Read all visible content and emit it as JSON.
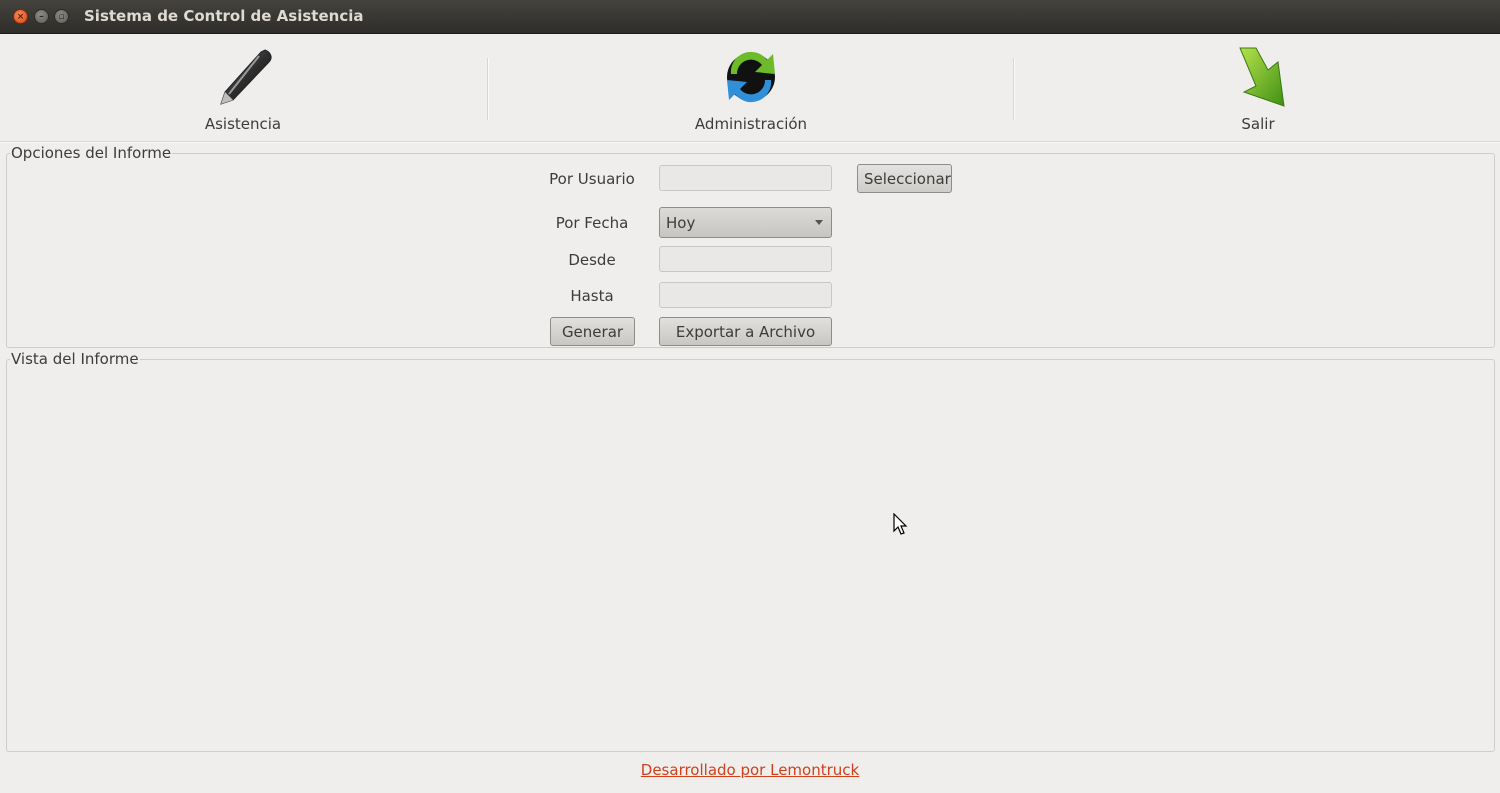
{
  "window": {
    "title": "Sistema de Control de Asistencia"
  },
  "toolbar": {
    "items": [
      {
        "label": "Asistencia",
        "icon": "pen-icon"
      },
      {
        "label": "Administración",
        "icon": "sync-icon"
      },
      {
        "label": "Salir",
        "icon": "exit-arrow-icon"
      }
    ]
  },
  "options": {
    "title": "Opciones del Informe",
    "por_usuario_label": "Por Usuario",
    "por_usuario_value": "",
    "seleccionar_label": "Seleccionar",
    "por_fecha_label": "Por Fecha",
    "por_fecha_value": "Hoy",
    "desde_label": "Desde",
    "desde_value": "",
    "hasta_label": "Hasta",
    "hasta_value": "",
    "generar_label": "Generar",
    "exportar_label": "Exportar a Archivo"
  },
  "view": {
    "title": "Vista del Informe"
  },
  "footer": {
    "credit": "Desarrollado por Lemontruck",
    "link_color": "#d0401a"
  }
}
